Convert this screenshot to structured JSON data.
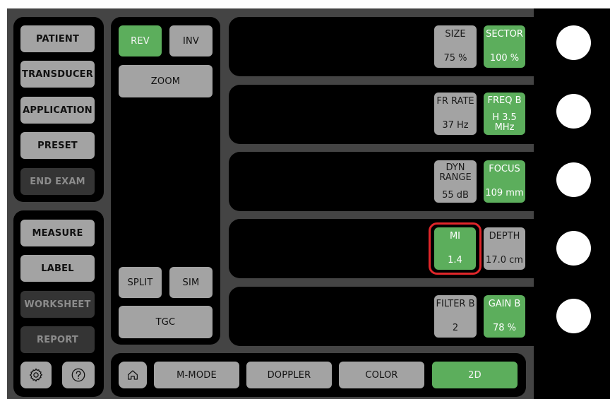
{
  "left_panel": {
    "patient": "PATIENT",
    "transducer": "TRANSDUCER",
    "application": "APPLICATION",
    "preset": "PRESET",
    "end_exam": "END EXAM"
  },
  "tools_panel": {
    "measure": "MEASURE",
    "label": "LABEL",
    "worksheet": "WORKSHEET",
    "report": "REPORT"
  },
  "image_panel": {
    "rev": "REV",
    "inv": "INV",
    "zoom": "ZOOM",
    "split": "SPLIT",
    "sim": "SIM",
    "tgc": "TGC"
  },
  "mode_bar": {
    "m_mode": "M-MODE",
    "doppler": "DOPPLER",
    "color": "COLOR",
    "two_d": "2D"
  },
  "controls": {
    "size": {
      "label": "SIZE",
      "value": "75 %"
    },
    "sector": {
      "label": "SECTOR",
      "value": "100 %"
    },
    "fr_rate": {
      "label": "FR RATE",
      "value": "37 Hz"
    },
    "freq_b": {
      "label": "FREQ B",
      "value_line1": "H 3.5",
      "value_line2": "MHz"
    },
    "dyn_range": {
      "label_line1": "DYN",
      "label_line2": "RANGE",
      "value": "55 dB"
    },
    "focus": {
      "label": "FOCUS",
      "value": "109 mm"
    },
    "mi": {
      "label": "MI",
      "value": "1.4"
    },
    "depth": {
      "label": "DEPTH",
      "value": "17.0 cm"
    },
    "filter_b": {
      "label": "FILTER B",
      "value": "2"
    },
    "gain_b": {
      "label": "GAIN B",
      "value": "78 %"
    }
  },
  "icons": {
    "settings": "gear-icon",
    "help": "question-icon",
    "home": "home-icon"
  },
  "colors": {
    "active_green": "#5cae5c",
    "button_gray": "#a3a3a3",
    "highlight_red": "#e0262a"
  }
}
